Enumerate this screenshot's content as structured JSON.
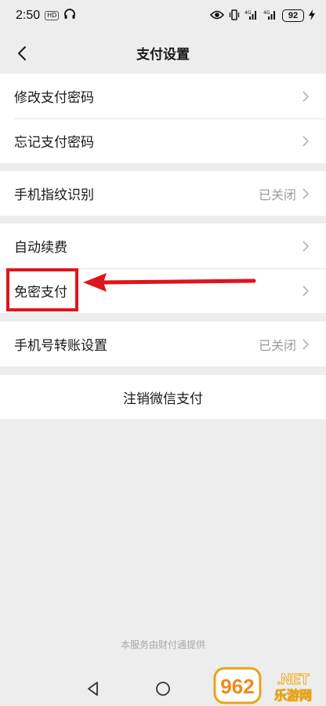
{
  "status_bar": {
    "time": "2:50",
    "badge": "HD",
    "battery": "92"
  },
  "header": {
    "title": "支付设置"
  },
  "groups": {
    "password": {
      "change": "修改支付密码",
      "forgot": "忘记支付密码"
    },
    "fingerprint": {
      "label": "手机指纹识别",
      "value": "已关闭"
    },
    "payments": {
      "auto_renew": "自动续费",
      "password_free": "免密支付"
    },
    "phone_transfer": {
      "label": "手机号转账设置",
      "value": "已关闭"
    },
    "cancel": {
      "label": "注销微信支付"
    }
  },
  "footer": {
    "note": "本服务由财付通提供"
  },
  "watermark": {
    "brand": "962.NET",
    "subtitle": "乐游网"
  },
  "colors": {
    "background": "#ededed",
    "highlight": "#e0141e",
    "muted": "#9b9b9b"
  }
}
